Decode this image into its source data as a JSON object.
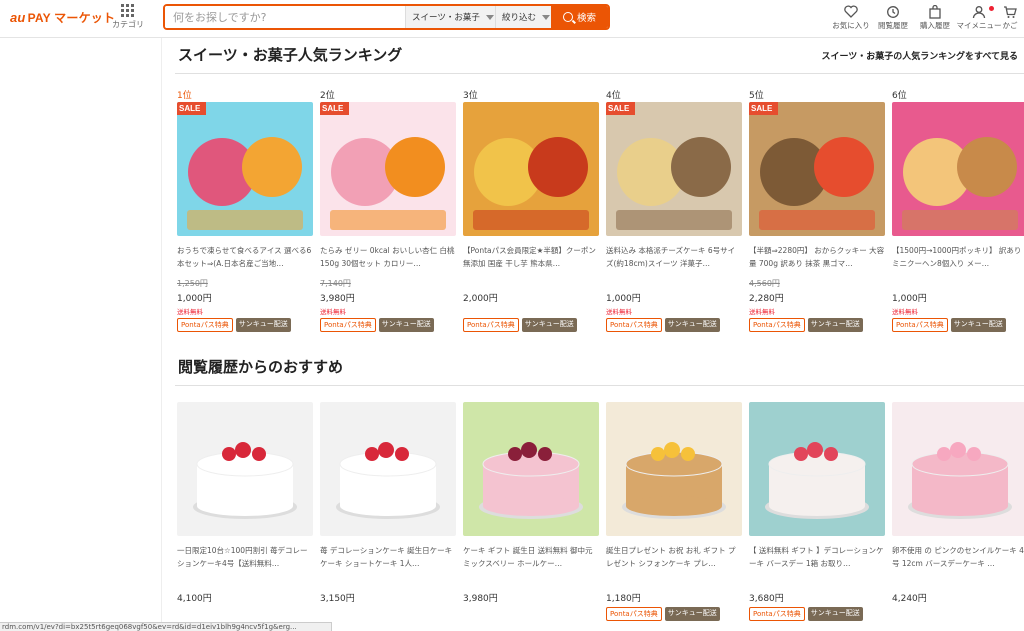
{
  "header": {
    "logo_prefix": "au",
    "logo_main": "PAY マーケット",
    "category_label": "カテゴリ",
    "search_placeholder": "何をお探しですか?",
    "category_select": "スイーツ・お菓子",
    "filter_select": "絞り込む",
    "search_button": "検索",
    "icons": [
      {
        "label": "お気に入り",
        "icon": "heart-icon"
      },
      {
        "label": "閲覧履歴",
        "icon": "history-icon"
      },
      {
        "label": "購入履歴",
        "icon": "bag-icon"
      },
      {
        "label": "マイメニュー",
        "icon": "user-icon"
      },
      {
        "label": "かご",
        "icon": "cart-icon"
      }
    ]
  },
  "ranking": {
    "title": "スイーツ・お菓子人気ランキング",
    "see_all": "スイーツ・お菓子の人気ランキングをすべて見る",
    "items": [
      {
        "rank": "1位",
        "sale": "SALE",
        "name": "おうちで凍らせて食べるアイス 選べる6本セット⇒(A.日本名産ご当地…",
        "old_price": "1,250円",
        "price": "1,000円",
        "shipping": "送料無料",
        "ponta": "Pontaパス特典",
        "sankyu": "サンキュー配送",
        "colors": [
          "#7fd6e8",
          "#e0577c",
          "#f3a533"
        ]
      },
      {
        "rank": "2位",
        "sale": "SALE",
        "name": "たらみ ゼリー 0kcal おいしい杏仁 白桃 150g 30個セット カロリー…",
        "old_price": "7,140円",
        "price": "3,980円",
        "shipping": "送料無料",
        "ponta": "Pontaパス特典",
        "sankyu": "サンキュー配送",
        "colors": [
          "#fbe3ea",
          "#f2a0b5",
          "#f28e1f"
        ]
      },
      {
        "rank": "3位",
        "sale": "",
        "name": "【Pontaパス会員限定★半額】クーポン 無添加 国産 干し芋 熊本県…",
        "old_price": "",
        "price": "2,000円",
        "shipping": "",
        "ponta": "Pontaパス特典",
        "sankyu": "サンキュー配送",
        "colors": [
          "#e6a23c",
          "#f1c34a",
          "#c83a1c"
        ]
      },
      {
        "rank": "4位",
        "sale": "SALE",
        "name": "送料込み 本格派チーズケーキ 6号サイズ(約18cm)スイーツ 洋菓子…",
        "old_price": "",
        "price": "1,000円",
        "shipping": "送料無料",
        "ponta": "Pontaパス特典",
        "sankyu": "サンキュー配送",
        "colors": [
          "#d8c8ae",
          "#e9cf8b",
          "#8a6a48"
        ]
      },
      {
        "rank": "5位",
        "sale": "SALE",
        "name": "【半額⇒2280円】 おからクッキー 大容量 700g 訳あり 抹茶 黒ゴマ…",
        "old_price": "4,560円",
        "price": "2,280円",
        "shipping": "送料無料",
        "ponta": "Pontaパス特典",
        "sankyu": "サンキュー配送",
        "colors": [
          "#c69a63",
          "#7d5a36",
          "#e64d2e"
        ]
      },
      {
        "rank": "6位",
        "sale": "",
        "name": "【1500円→1000円ポッキリ】 訳ありミニクーヘン8個入り メー…",
        "old_price": "",
        "price": "1,000円",
        "shipping": "送料無料",
        "ponta": "Pontaパス特典",
        "sankyu": "サンキュー配送",
        "colors": [
          "#e85a8e",
          "#f3c57a",
          "#c88a4a"
        ]
      }
    ]
  },
  "recommend": {
    "title": "閲覧履歴からのおすすめ",
    "items": [
      {
        "name": "一日限定10台☆100円割引 苺デコレーションケーキ4号【送料無料…",
        "price": "4,100円",
        "badges": false,
        "colors": [
          "#f2f2f2",
          "#ffffff",
          "#d8283a"
        ]
      },
      {
        "name": "苺 デコレーションケーキ 誕生日ケーキ ケーキ ショートケーキ 1人…",
        "price": "3,150円",
        "badges": false,
        "colors": [
          "#f2f2f2",
          "#ffffff",
          "#d8283a"
        ]
      },
      {
        "name": "ケーキ ギフト 誕生日 送料無料 御中元 ミックスベリー ホールケー…",
        "price": "3,980円",
        "badges": false,
        "colors": [
          "#cfe6a8",
          "#f4c3d0",
          "#8a1f3a"
        ]
      },
      {
        "name": "誕生日プレゼント お祝 お礼 ギフト プレゼント シフォンケーキ プレ…",
        "price": "1,180円",
        "badges": true,
        "ponta": "Pontaパス特典",
        "sankyu": "サンキュー配送",
        "colors": [
          "#f3ead8",
          "#d8a76a",
          "#f6c13a"
        ]
      },
      {
        "name": "【 送料無料 ギフト 】デコレーションケーキ バースデー 1箱 お取り…",
        "price": "3,680円",
        "badges": true,
        "ponta": "Pontaパス特典",
        "sankyu": "サンキュー配送",
        "colors": [
          "#9ed0cf",
          "#f5f0ee",
          "#e2455a"
        ]
      },
      {
        "name": "卵不使用 の ピンクのセンイルケーキ 4号 12cm バースデーケーキ …",
        "price": "4,240円",
        "badges": false,
        "colors": [
          "#f7ebee",
          "#f4b8c8",
          "#f7a8c0"
        ]
      }
    ]
  },
  "status_url": "rdm.com/v1/ev?di=bx25t5rt6geq068vgf50&ev=rd&id=d1eiv1blh9g4ncv5f1g&erg..."
}
